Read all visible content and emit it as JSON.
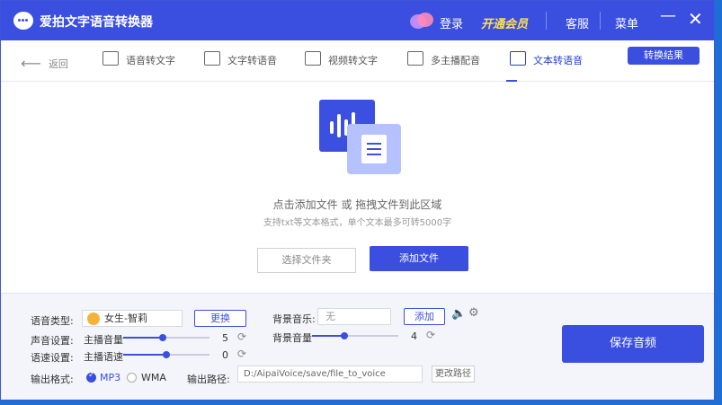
{
  "window": {
    "title": "爱拍文字语音转换器"
  },
  "titlebar": {
    "login": "登录",
    "vip": "开通会员",
    "service": "客服",
    "menu": "菜单",
    "minimize": "—",
    "close": "✕"
  },
  "nav": {
    "back": "返回",
    "items": [
      {
        "label": "语音转文字"
      },
      {
        "label": "文字转语音"
      },
      {
        "label": "视频转文字"
      },
      {
        "label": "多主播配音"
      },
      {
        "label": "文本转语音"
      }
    ],
    "result_button": "转换结果"
  },
  "drop": {
    "title": "点击添加文件 或 拖拽文件到此区域",
    "subtitle": "支持txt等文本格式，单个文本最多可转5000字",
    "select_folder": "选择文件夹",
    "add_file": "添加文件"
  },
  "settings": {
    "voice_type_label": "语音类型:",
    "voice_name": "女生-智莉",
    "change_button": "更换",
    "sound_label": "声音设置:",
    "host_volume_label": "主播音量",
    "host_volume": "5",
    "speed_label": "语速设置:",
    "host_speed_label": "主播语速",
    "host_speed": "0",
    "bgm_label": "背景音乐:",
    "bgm_value": "无",
    "bgm_add": "添加",
    "bg_volume_label": "背景音量",
    "bg_volume": "4",
    "format_label": "输出格式:",
    "format_mp3": "MP3",
    "format_wma": "WMA",
    "path_label": "输出路径:",
    "path_value": "D:/AipaiVoice/save/file_to_voice",
    "change_path": "更改路径",
    "save_button": "保存音频"
  },
  "colors": {
    "accent": "#3a4fe0",
    "vip": "#ffe14d"
  }
}
